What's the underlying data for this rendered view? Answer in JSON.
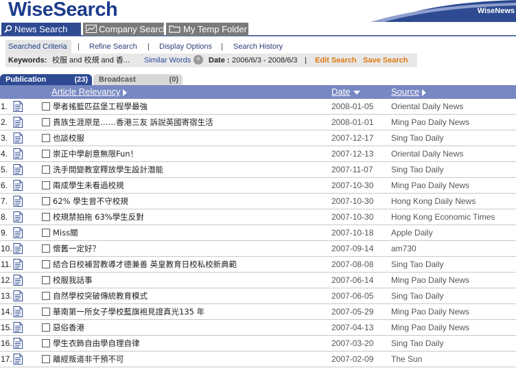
{
  "app": {
    "logo": "WiseSearch",
    "brand_right": "WiseNews"
  },
  "main_tabs": [
    {
      "label": "News Search",
      "icon": "search-icon",
      "active": true
    },
    {
      "label": "Company Search",
      "icon": "chart-icon",
      "active": false
    },
    {
      "label": "My Temp Folder",
      "icon": "folder-icon",
      "active": false
    }
  ],
  "subnav": {
    "searched_criteria": "Searched Criteria",
    "refine_search": "Refine Search",
    "display_options": "Display Options",
    "search_history": "Search History",
    "sep": "|"
  },
  "criteria": {
    "keywords_label": "Keywords:",
    "keywords_value": "校服 and 校規 and 香...",
    "similar_words": "Similar Words",
    "date_label": "Date :",
    "date_value": "2006/6/3 - 2008/6/3",
    "sep": "|",
    "edit_search": "Edit Search",
    "save_search": "Save Search"
  },
  "source_tabs": {
    "publication": {
      "label": "Publication",
      "count": "(23)"
    },
    "broadcast": {
      "label": "Broadcast",
      "count": "(0)"
    }
  },
  "columns": {
    "article": "Article Relevancy",
    "date": "Date",
    "source": "Source"
  },
  "colors": {
    "brand": "#1d3c8c",
    "tab_active": "#2d4a92",
    "header_bar": "#7788c2",
    "action": "#e07a10"
  },
  "rows": [
    {
      "num": "1.",
      "title": "學者搖籃匹茲堡工程學最強",
      "date": "2008-01-05",
      "source": "Oriental Daily News"
    },
    {
      "num": "2.",
      "title": "貴族生涯原是……香港三友 訴說英國寄宿生活",
      "date": "2008-01-01",
      "source": "Ming Pao Daily News"
    },
    {
      "num": "3.",
      "title": "也談校服",
      "date": "2007-12-17",
      "source": "Sing Tao Daily"
    },
    {
      "num": "4.",
      "title": "崇正中學創意無限Fun！",
      "date": "2007-12-13",
      "source": "Oriental Daily News"
    },
    {
      "num": "5.",
      "title": "洗手間變教室釋放學生設計潛能",
      "date": "2007-11-07",
      "source": "Sing Tao Daily"
    },
    {
      "num": "6.",
      "title": "兩成學生未看過校規",
      "date": "2007-10-30",
      "source": "Ming Pao Daily News"
    },
    {
      "num": "7.",
      "title": "62% 學生曾不守校規",
      "date": "2007-10-30",
      "source": "Hong Kong Daily News"
    },
    {
      "num": "8.",
      "title": "校規禁拍拖 63%學生反對",
      "date": "2007-10-30",
      "source": "Hong Kong Economic Times"
    },
    {
      "num": "9.",
      "title": "Miss關",
      "date": "2007-10-18",
      "source": "Apple Daily"
    },
    {
      "num": "10.",
      "title": "懷舊一定好？",
      "date": "2007-09-14",
      "source": "am730"
    },
    {
      "num": "11.",
      "title": "結合日校補習教導才德兼善 英皇教育日校私校新典範",
      "date": "2007-08-08",
      "source": "Sing Tao Daily"
    },
    {
      "num": "12.",
      "title": "校服我話事",
      "date": "2007-06-14",
      "source": "Ming Pao Daily News"
    },
    {
      "num": "13.",
      "title": "自然學校突破傳統教育模式",
      "date": "2007-06-05",
      "source": "Sing Tao Daily"
    },
    {
      "num": "14.",
      "title": "華南第一所女子學校藍旗袍見證真光135 年",
      "date": "2007-05-29",
      "source": "Ming Pao Daily News"
    },
    {
      "num": "15.",
      "title": "惡俗香港",
      "date": "2007-04-13",
      "source": "Ming Pao Daily News"
    },
    {
      "num": "16.",
      "title": "學生衣飾自由學自理自律",
      "date": "2007-03-20",
      "source": "Sing Tao Daily"
    },
    {
      "num": "17.",
      "title": "離經叛道非干預不可",
      "date": "2007-02-09",
      "source": "The Sun"
    }
  ]
}
